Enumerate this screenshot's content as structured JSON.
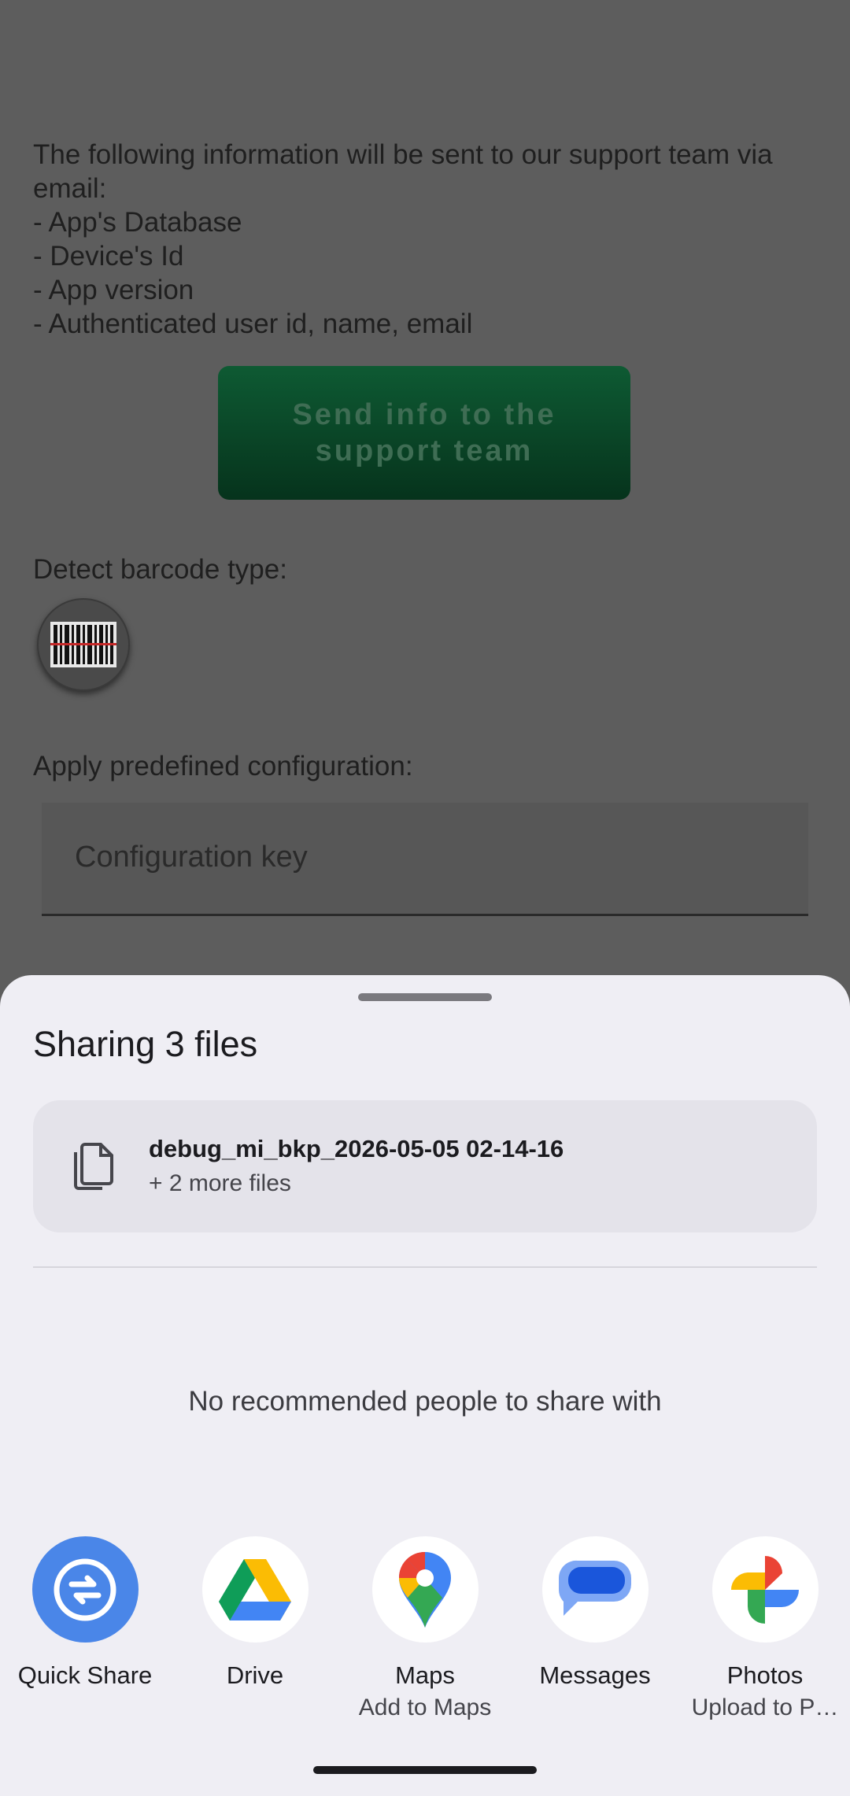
{
  "background_app": {
    "info_text": "The following information will be sent to our support team via email:\n - App's Database\n - Device's Id\n - App version\n - Authenticated user id, name, email",
    "send_button_label": "Send info to the\nsupport team",
    "detect_barcode_label": "Detect barcode type:",
    "predefined_config_label": "Apply predefined configuration:",
    "config_key_placeholder": "Configuration key"
  },
  "share_sheet": {
    "title": "Sharing 3 files",
    "file": {
      "name": "debug_mi_bkp_2026-05-05 02-14-16",
      "more": "+ 2 more files",
      "icon": "copy-files-icon"
    },
    "no_people_text": "No recommended people to share with",
    "apps": [
      {
        "label": "Quick Share",
        "sub": "",
        "icon": "quick-share-icon"
      },
      {
        "label": "Drive",
        "sub": "",
        "icon": "drive-icon"
      },
      {
        "label": "Maps",
        "sub": "Add to Maps",
        "icon": "maps-icon"
      },
      {
        "label": "Messages",
        "sub": "",
        "icon": "messages-icon"
      },
      {
        "label": "Photos",
        "sub": "Upload to P…",
        "icon": "photos-icon"
      }
    ]
  },
  "colors": {
    "sheet_bg": "#efeef4",
    "quick_share_blue": "#4a86e8",
    "send_button_green": "#0e5a33"
  }
}
